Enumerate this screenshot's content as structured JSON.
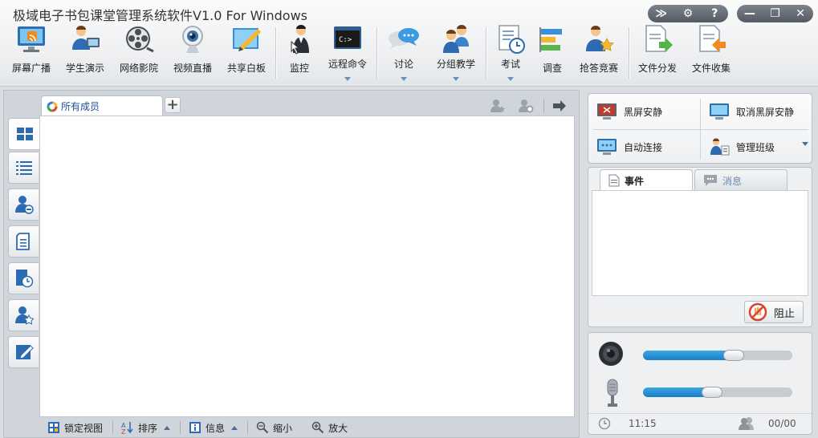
{
  "window": {
    "title": "极域电子书包课堂管理系统软件V1.0 For Windows"
  },
  "window_controls": {
    "collapse": "≫",
    "settings": "⚙",
    "help": "?",
    "minimize": "—",
    "restore": "❐",
    "close": "✕"
  },
  "toolbar": {
    "screen_broadcast": "屏幕广播",
    "student_demo": "学生演示",
    "network_cinema": "网络影院",
    "video_live": "视频直播",
    "shared_whiteboard": "共享白板",
    "monitor": "监控",
    "remote_command": "远程命令",
    "discussion": "讨论",
    "group_teaching": "分组教学",
    "exam": "考试",
    "survey": "调查",
    "quick_answer": "抢答竞赛",
    "file_distribute": "文件分发",
    "file_collect": "文件收集"
  },
  "members": {
    "tab_label": "所有成员",
    "add_tab": "+"
  },
  "statusbar": {
    "lock_view": "锁定视图",
    "sort": "排序",
    "info": "信息",
    "zoom_out": "缩小",
    "zoom_in": "放大"
  },
  "quick_actions": {
    "black_screen": "黑屏安静",
    "cancel_black_screen": "取消黑屏安静",
    "auto_connect": "自动连接",
    "manage_class": "管理班级"
  },
  "events": {
    "tab_events": "事件",
    "tab_messages": "消息",
    "block_button": "阻止"
  },
  "audio": {
    "speaker_level": 0.61,
    "mic_level": 0.46,
    "time": "11:15",
    "online_count": "00/00"
  },
  "colors": {
    "accent": "#1f4e9a",
    "slider_fill": "#1a7fc5"
  }
}
